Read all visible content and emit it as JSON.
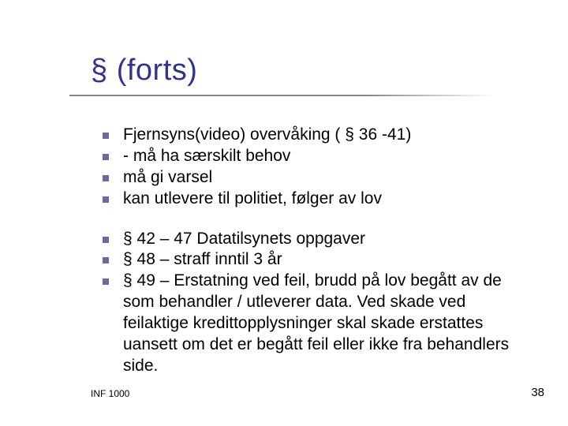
{
  "title": "§ (forts)",
  "groups": [
    {
      "items": [
        "Fjernsyns(video) overvåking ( § 36 -41)",
        " -   må ha særskilt behov",
        "må gi varsel",
        " kan utlevere til politiet, følger av lov"
      ]
    },
    {
      "items": [
        "§ 42 – 47 Datatilsynets oppgaver",
        "§ 48 – straff  inntil 3 år",
        "§ 49 – Erstatning ved feil, brudd på lov begått av de som behandler / utleverer data. Ved skade ved feilaktige kredittopplysninger skal skade erstattes uansett om det er begått feil eller ikke fra behandlers side."
      ]
    }
  ],
  "footer": {
    "left": "INF 1000",
    "right": "38"
  }
}
